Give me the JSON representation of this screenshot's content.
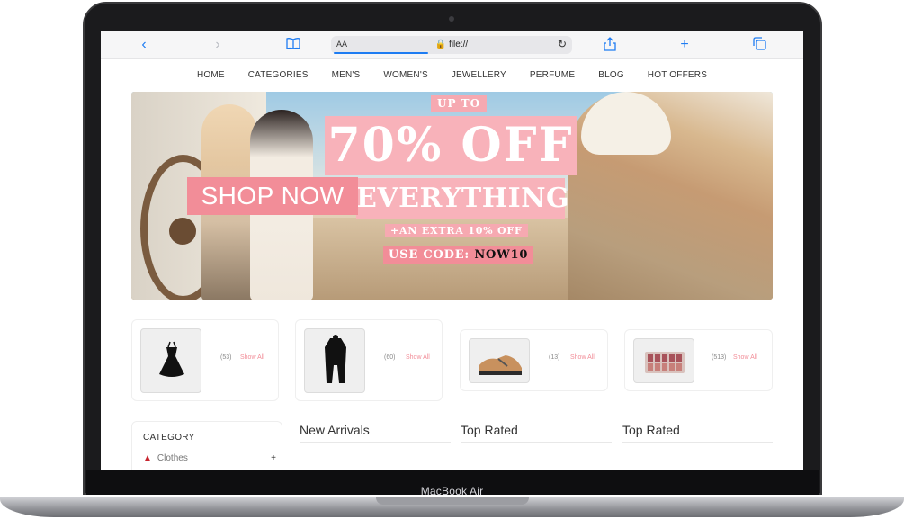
{
  "device": {
    "label": "MacBook Air"
  },
  "browser": {
    "back_icon": "chevron-left-icon",
    "forward_icon": "chevron-right-icon",
    "bookmarks_icon": "book-icon",
    "text_size": "AA",
    "url": "file://",
    "reload_icon": "reload-icon",
    "share_icon": "share-icon",
    "new_tab_icon": "plus-icon",
    "tabs_icon": "tabs-icon",
    "accent": "#1e7cf2"
  },
  "nav": {
    "items": [
      "HOME",
      "CATEGORIES",
      "MEN'S",
      "WOMEN'S",
      "JEWELLERY",
      "PERFUME",
      "BLOG",
      "HOT OFFERS"
    ]
  },
  "hero": {
    "shop_now": "SHOP NOW",
    "up_to": "UP TO",
    "headline": "70% OFF",
    "subheadline": "EVERYTHING",
    "extra": "+AN EXTRA 10% OFF",
    "code_label": "USE CODE:",
    "code": "NOW10",
    "accent": "#f28d98"
  },
  "categories": [
    {
      "icon": "dress-icon",
      "count": "(53)",
      "link": "Show All"
    },
    {
      "icon": "coat-icon",
      "count": "(60)",
      "link": "Show All"
    },
    {
      "icon": "sneaker-icon",
      "count": "(13)",
      "link": "Show All"
    },
    {
      "icon": "palette-icon",
      "count": "(513)",
      "link": "Show All"
    }
  ],
  "sidebar": {
    "title": "CATEGORY",
    "items": [
      {
        "label": "Clothes",
        "icon": "dress-icon",
        "expand": "+"
      }
    ]
  },
  "sections": [
    "New Arrivals",
    "Top Rated",
    "Top Rated"
  ]
}
